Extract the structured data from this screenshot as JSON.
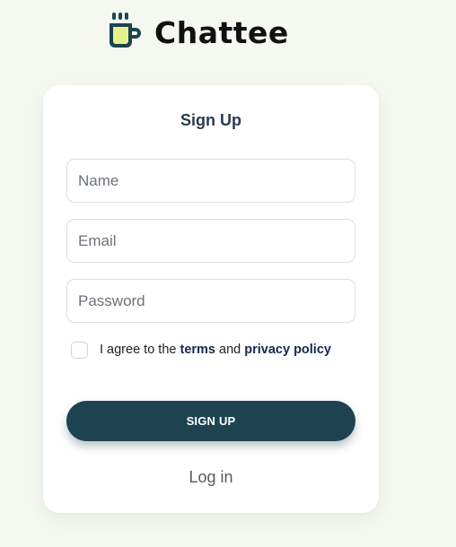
{
  "brand": {
    "name": "Chattee",
    "icon": "coffee-cup-icon",
    "colors": {
      "cup_fill": "#e3f28c",
      "cup_outline": "#1d4350",
      "steam": "#1d4350"
    }
  },
  "form": {
    "title": "Sign Up",
    "fields": {
      "name": {
        "placeholder": "Name",
        "value": ""
      },
      "email": {
        "placeholder": "Email",
        "value": ""
      },
      "password": {
        "placeholder": "Password",
        "value": ""
      }
    },
    "agree": {
      "checked": false,
      "prefix": "I agree to the",
      "terms_label": "terms",
      "conjunction": "and",
      "privacy_label": "privacy policy"
    },
    "submit_label": "SIGN UP",
    "login_label": "Log in"
  },
  "colors": {
    "page_background": "#f4f8f1",
    "card_background": "#ffffff",
    "primary_button": "#1d4350",
    "link_emphasis": "#132a4d"
  }
}
